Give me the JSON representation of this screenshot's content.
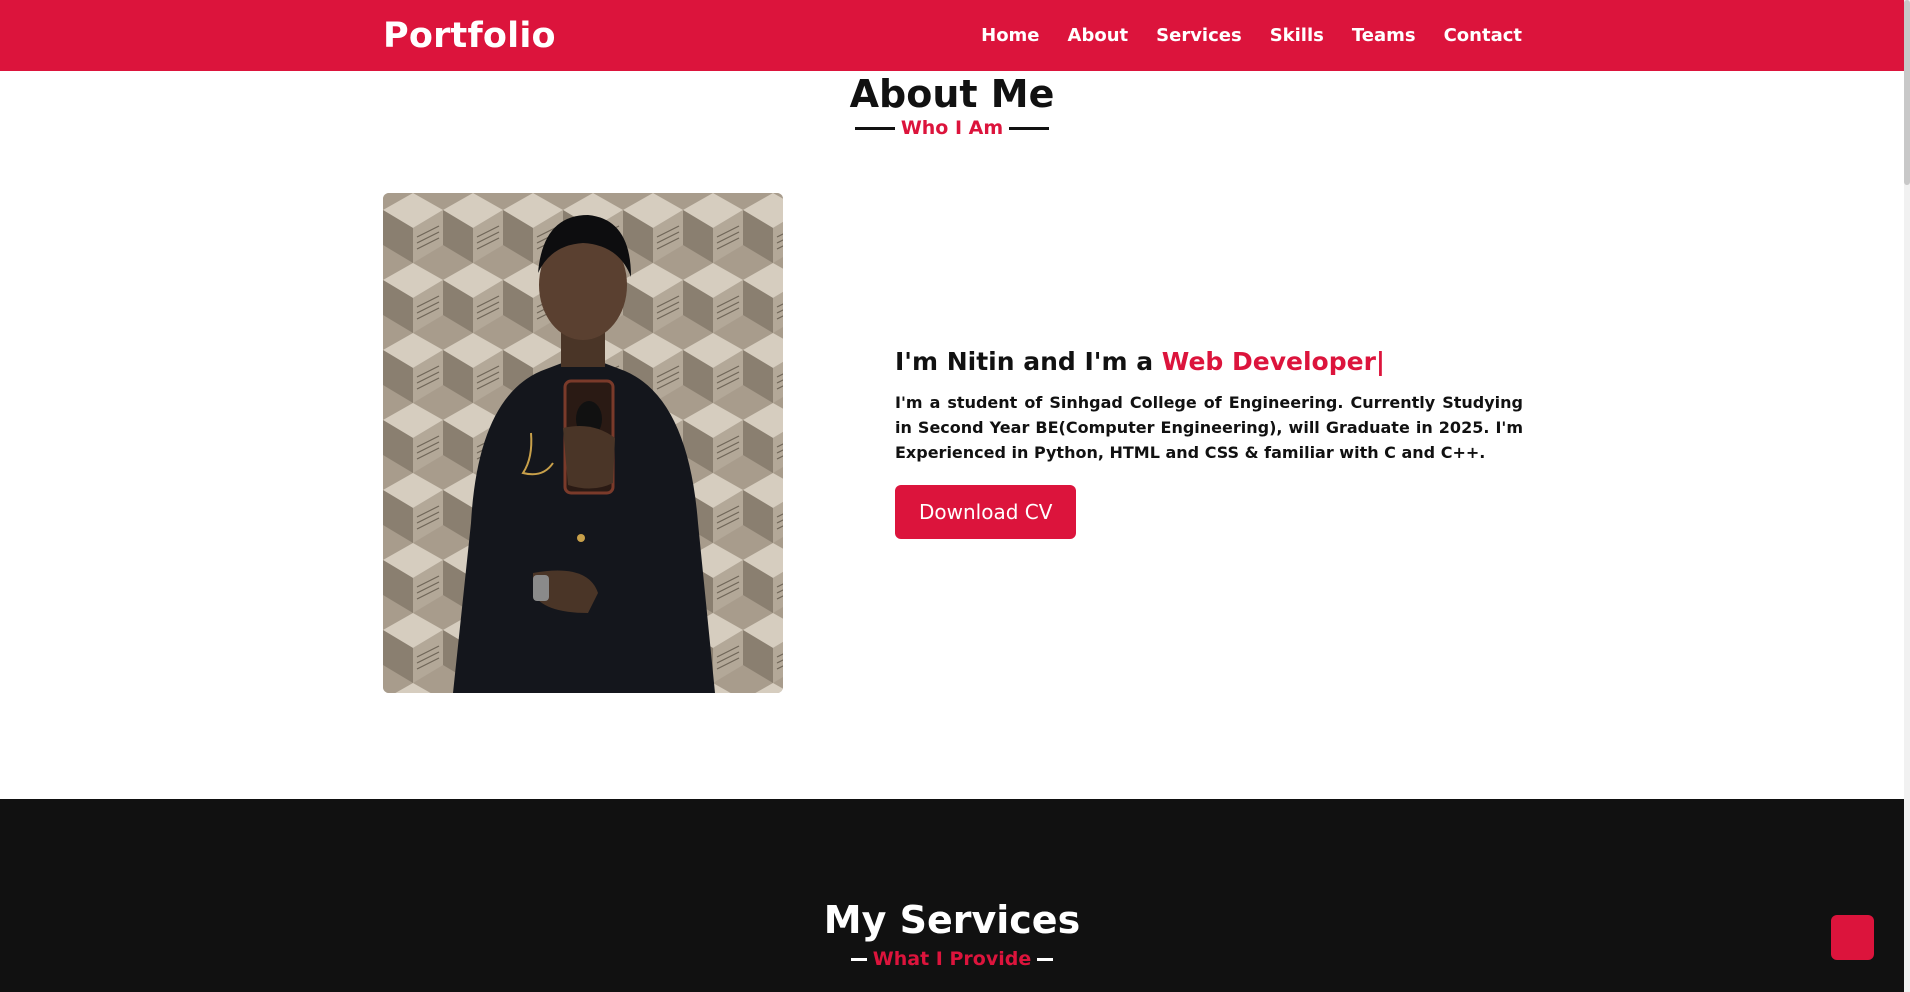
{
  "nav": {
    "logo": "Portfolio",
    "items": [
      {
        "label": "Home"
      },
      {
        "label": "About"
      },
      {
        "label": "Services"
      },
      {
        "label": "Skills"
      },
      {
        "label": "Teams"
      },
      {
        "label": "Contact"
      }
    ]
  },
  "about": {
    "title": "About Me",
    "subtitle": "Who I Am",
    "heading_prefix": "I'm Nitin and I'm a ",
    "heading_role": "Web Developer|",
    "text": "I'm a student of Sinhgad College of Engineering. Currently Studying in Second Year BE(Computer Engineering), will Graduate in 2025. I'm Experienced in Python, HTML and CSS & familiar with C and C++.",
    "button_label": "Download CV"
  },
  "services": {
    "title": "My Services",
    "subtitle": "What I Provide"
  },
  "colors": {
    "accent": "#dc143c",
    "dark": "#111111",
    "light": "#ffffff"
  },
  "icons": {
    "scroll_up": "arrow-up-icon"
  }
}
